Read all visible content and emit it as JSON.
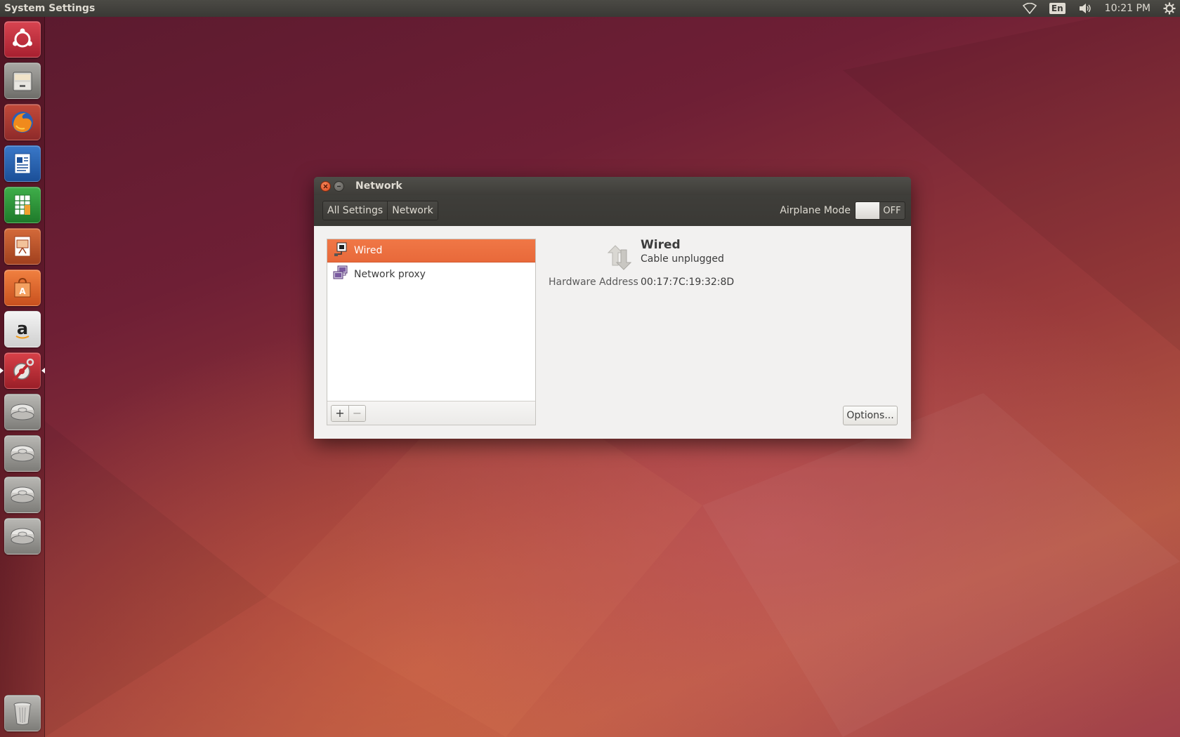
{
  "top_panel": {
    "app_title": "System Settings",
    "keyboard_layout": "En",
    "clock": "10:21 PM",
    "icons": [
      "wifi-icon",
      "volume-icon",
      "gear-icon"
    ]
  },
  "launcher": {
    "items": [
      {
        "name": "ubuntu-dash",
        "color": "#c9303a"
      },
      {
        "name": "files",
        "color": "#8b8a86"
      },
      {
        "name": "firefox",
        "color": "#e8741c"
      },
      {
        "name": "libreoffice-writer",
        "color": "#1e5aa8"
      },
      {
        "name": "libreoffice-calc",
        "color": "#2e9b3a"
      },
      {
        "name": "libreoffice-impress",
        "color": "#c0582a"
      },
      {
        "name": "ubuntu-software-center",
        "color": "#e26b2c"
      },
      {
        "name": "amazon",
        "color": "#e9e9e9"
      },
      {
        "name": "system-settings",
        "color": "#c0282e"
      },
      {
        "name": "drive-1",
        "color": "#9a9995"
      },
      {
        "name": "drive-2",
        "color": "#9a9995"
      },
      {
        "name": "drive-3",
        "color": "#9a9995"
      },
      {
        "name": "drive-4",
        "color": "#9a9995"
      },
      {
        "name": "trash",
        "color": "#9a9995"
      }
    ]
  },
  "window": {
    "title": "Network",
    "breadcrumb": [
      "All Settings",
      "Network"
    ],
    "airplane_mode": {
      "label": "Airplane Mode",
      "state": "OFF"
    },
    "connections": [
      {
        "label": "Wired",
        "selected": true
      },
      {
        "label": "Network proxy",
        "selected": false
      }
    ],
    "list_buttons": {
      "add": "+",
      "remove": "−"
    },
    "device": {
      "name": "Wired",
      "status": "Cable unplugged",
      "hardware_address_label": "Hardware Address",
      "hardware_address": "00:17:7C:19:32:8D"
    },
    "options_button": "Options..."
  },
  "colors": {
    "accent": "#e8693a",
    "panel": "#3c3b37",
    "window_bg": "#f2f1f0"
  }
}
